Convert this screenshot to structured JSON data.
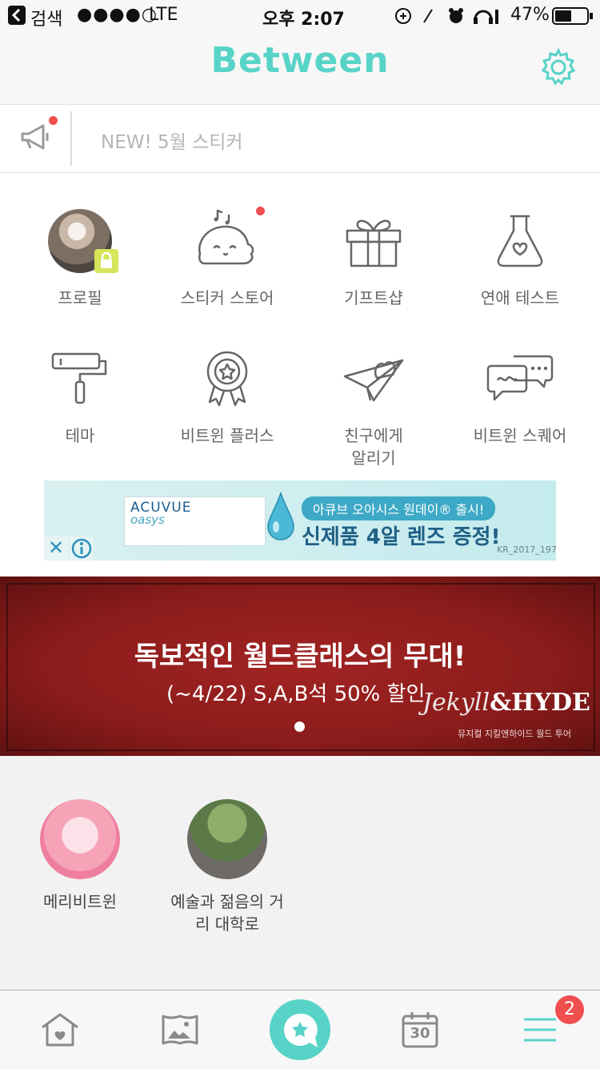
{
  "status_bar": {
    "back_app": "검색",
    "carrier": "●●●●○",
    "network": "LTE",
    "time": "오후 2:07",
    "battery": "47%"
  },
  "header": {
    "title": "Between",
    "accent_color": "#58d3c8"
  },
  "notice": {
    "text": "NEW! 5월 스티커"
  },
  "menu": {
    "items": [
      {
        "label": "프로필",
        "icon": "profile-avatar"
      },
      {
        "label": "스티커 스토어",
        "icon": "sticker-icon"
      },
      {
        "label": "기프트샵",
        "icon": "gift-icon"
      },
      {
        "label": "연애 테스트",
        "icon": "flask-heart-icon"
      },
      {
        "label": "테마",
        "icon": "paint-roller-icon"
      },
      {
        "label": "비트윈 플러스",
        "icon": "award-star-icon"
      },
      {
        "label": "친구에게\n알리기",
        "icon": "paper-plane-heart-icon"
      },
      {
        "label": "비트윈 스퀘어",
        "icon": "chat-bubbles-icon"
      }
    ]
  },
  "ad": {
    "brand": "ACUVUE",
    "product": "oasys",
    "tag": "아큐브 오아시스 원데이® 출시!",
    "headline": "신제품 4알 렌즈 증정!",
    "code": "KR_2017_197",
    "close_glyph": "✕"
  },
  "banner": {
    "title": "독보적인 월드클래스의 무대!",
    "subtitle": "(~4/22) S,A,B석 50% 할인",
    "logo_script": "Jekyll",
    "logo_bold": "&HYDE",
    "logo_sub": "뮤지컬 지킬앤하이드 월드 투어"
  },
  "stories": [
    {
      "label": "메리비트윈"
    },
    {
      "label": "예술과 젊음의 거\n리 대학로"
    }
  ],
  "tabbar": {
    "calendar_day": "30",
    "badge_count": "2",
    "tabs": [
      "home-heart-icon",
      "photo-album-icon",
      "chat-star-icon",
      "calendar-icon",
      "menu-icon"
    ]
  }
}
